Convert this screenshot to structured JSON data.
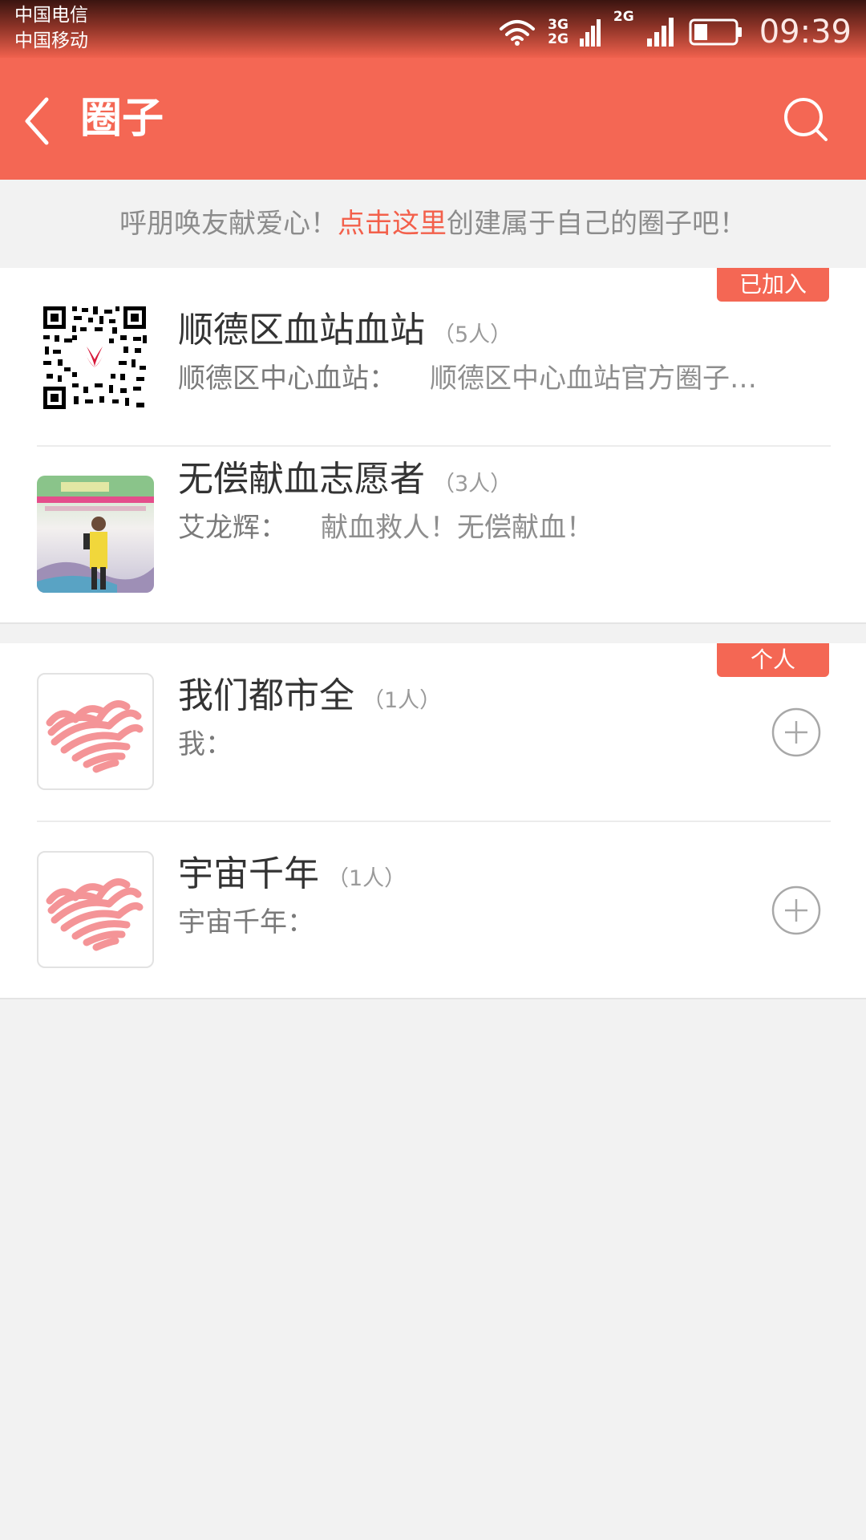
{
  "status_bar": {
    "carrier_1": "中国电信",
    "carrier_2": "中国移动",
    "net_1_top": "3G",
    "net_1_bottom": "2G",
    "net_2": "2G",
    "time": "09:39"
  },
  "header": {
    "title": "圈子",
    "back_icon": "back-arrow-icon",
    "search_icon": "search-icon"
  },
  "banner": {
    "prefix": "呼朋唤友献爱心！",
    "link": "点击这里",
    "suffix": "创建属于自己的圈子吧！"
  },
  "joined_section": {
    "tag": "已加入",
    "items": [
      {
        "name": "顺德区血站血站",
        "count": "（5人）",
        "author": "顺德区中心血站：",
        "message": "顺德区中心血站官方圈子…",
        "avatar": "qr-code"
      },
      {
        "name": "无偿献血志愿者",
        "count": "（3人）",
        "author": "艾龙辉：",
        "message": "献血救人！无偿献血！",
        "avatar": "photo"
      }
    ]
  },
  "personal_section": {
    "tag": "个人",
    "items": [
      {
        "name": "我们都市全",
        "count": "（1人）",
        "author": "我：",
        "message": "",
        "avatar": "heart-scribble"
      },
      {
        "name": "宇宙千年",
        "count": "（1人）",
        "author": "宇宙千年：",
        "message": "",
        "avatar": "heart-scribble"
      }
    ]
  },
  "colors": {
    "accent": "#f46754",
    "link": "#f3604b",
    "background": "#f2f2f2"
  }
}
